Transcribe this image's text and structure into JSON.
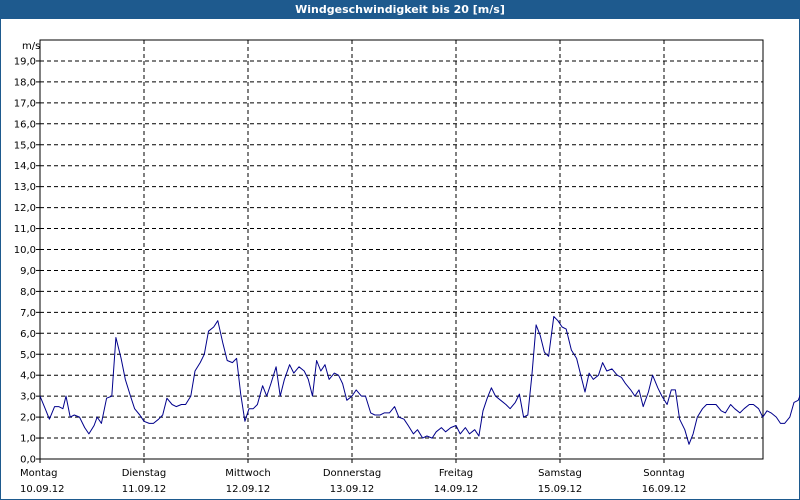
{
  "window": {
    "title": "Windgeschwindigkeit bis 20 [m/s]"
  },
  "colors": {
    "titlebar": "#1e5a8e",
    "series": "#00008b",
    "grid": "#000000"
  },
  "chart_data": {
    "type": "line",
    "title": "Windgeschwindigkeit bis 20 [m/s]",
    "ylabel": "m/s",
    "ylim": [
      0,
      20
    ],
    "ytick_labels": [
      "0,0",
      "1,0",
      "2,0",
      "3,0",
      "4,0",
      "5,0",
      "6,0",
      "7,0",
      "8,0",
      "9,0",
      "10,0",
      "11,0",
      "12,0",
      "13,0",
      "14,0",
      "15,0",
      "16,0",
      "17,0",
      "18,0",
      "19,0"
    ],
    "xlim": [
      0,
      7
    ],
    "grid": true,
    "days": [
      {
        "weekday": "Montag",
        "date": "10.09.12"
      },
      {
        "weekday": "Dienstag",
        "date": "11.09.12"
      },
      {
        "weekday": "Mittwoch",
        "date": "12.09.12"
      },
      {
        "weekday": "Donnerstag",
        "date": "13.09.12"
      },
      {
        "weekday": "Freitag",
        "date": "14.09.12"
      },
      {
        "weekday": "Samstag",
        "date": "15.09.12"
      },
      {
        "weekday": "Sonntag",
        "date": "16.09.12"
      }
    ],
    "series": [
      {
        "values": [
          [
            0.0,
            3.0
          ],
          [
            0.05,
            2.4
          ],
          [
            0.09,
            1.9
          ],
          [
            0.14,
            2.5
          ],
          [
            0.18,
            2.5
          ],
          [
            0.22,
            2.4
          ],
          [
            0.25,
            3.0
          ],
          [
            0.29,
            2.0
          ],
          [
            0.33,
            2.1
          ],
          [
            0.38,
            2.0
          ],
          [
            0.43,
            1.5
          ],
          [
            0.47,
            1.2
          ],
          [
            0.52,
            1.6
          ],
          [
            0.55,
            2.0
          ],
          [
            0.59,
            1.7
          ],
          [
            0.64,
            2.9
          ],
          [
            0.69,
            3.0
          ],
          [
            0.73,
            5.8
          ],
          [
            0.78,
            4.8
          ],
          [
            0.82,
            3.8
          ],
          [
            0.87,
            3.0
          ],
          [
            0.91,
            2.4
          ],
          [
            0.96,
            2.1
          ],
          [
            1.0,
            1.8
          ],
          [
            1.05,
            1.7
          ],
          [
            1.09,
            1.7
          ],
          [
            1.14,
            1.9
          ],
          [
            1.18,
            2.1
          ],
          [
            1.22,
            2.9
          ],
          [
            1.27,
            2.6
          ],
          [
            1.31,
            2.5
          ],
          [
            1.36,
            2.6
          ],
          [
            1.4,
            2.6
          ],
          [
            1.45,
            3.0
          ],
          [
            1.49,
            4.2
          ],
          [
            1.54,
            4.6
          ],
          [
            1.58,
            5.0
          ],
          [
            1.62,
            6.1
          ],
          [
            1.67,
            6.3
          ],
          [
            1.71,
            6.6
          ],
          [
            1.76,
            5.5
          ],
          [
            1.8,
            4.7
          ],
          [
            1.85,
            4.6
          ],
          [
            1.89,
            4.8
          ],
          [
            1.93,
            3.1
          ],
          [
            1.97,
            1.8
          ],
          [
            2.01,
            2.4
          ],
          [
            2.05,
            2.4
          ],
          [
            2.09,
            2.6
          ],
          [
            2.14,
            3.5
          ],
          [
            2.18,
            3.0
          ],
          [
            2.22,
            3.6
          ],
          [
            2.27,
            4.4
          ],
          [
            2.31,
            3.0
          ],
          [
            2.35,
            3.8
          ],
          [
            2.4,
            4.5
          ],
          [
            2.44,
            4.1
          ],
          [
            2.49,
            4.4
          ],
          [
            2.54,
            4.2
          ],
          [
            2.58,
            3.8
          ],
          [
            2.62,
            3.0
          ],
          [
            2.66,
            4.7
          ],
          [
            2.7,
            4.2
          ],
          [
            2.74,
            4.5
          ],
          [
            2.78,
            3.8
          ],
          [
            2.83,
            4.1
          ],
          [
            2.87,
            4.0
          ],
          [
            2.91,
            3.6
          ],
          [
            2.95,
            2.8
          ],
          [
            3.0,
            3.0
          ],
          [
            3.04,
            3.3
          ],
          [
            3.09,
            3.0
          ],
          [
            3.13,
            3.0
          ],
          [
            3.18,
            2.2
          ],
          [
            3.22,
            2.1
          ],
          [
            3.27,
            2.1
          ],
          [
            3.31,
            2.2
          ],
          [
            3.36,
            2.2
          ],
          [
            3.41,
            2.5
          ],
          [
            3.45,
            2.0
          ],
          [
            3.5,
            1.9
          ],
          [
            3.54,
            1.6
          ],
          [
            3.59,
            1.2
          ],
          [
            3.63,
            1.4
          ],
          [
            3.68,
            1.0
          ],
          [
            3.72,
            1.1
          ],
          [
            3.77,
            1.0
          ],
          [
            3.81,
            1.3
          ],
          [
            3.86,
            1.5
          ],
          [
            3.9,
            1.3
          ],
          [
            3.95,
            1.5
          ],
          [
            4.0,
            1.6
          ],
          [
            4.04,
            1.2
          ],
          [
            4.09,
            1.5
          ],
          [
            4.13,
            1.2
          ],
          [
            4.18,
            1.4
          ],
          [
            4.22,
            1.1
          ],
          [
            4.26,
            2.3
          ],
          [
            4.3,
            2.9
          ],
          [
            4.34,
            3.4
          ],
          [
            4.38,
            3.0
          ],
          [
            4.43,
            2.8
          ],
          [
            4.48,
            2.6
          ],
          [
            4.52,
            2.4
          ],
          [
            4.57,
            2.7
          ],
          [
            4.61,
            3.1
          ],
          [
            4.65,
            2.0
          ],
          [
            4.69,
            2.1
          ],
          [
            4.73,
            4.0
          ],
          [
            4.77,
            6.4
          ],
          [
            4.81,
            5.9
          ],
          [
            4.85,
            5.1
          ],
          [
            4.89,
            4.9
          ],
          [
            4.94,
            6.8
          ],
          [
            4.98,
            6.6
          ],
          [
            5.02,
            6.3
          ],
          [
            5.06,
            6.2
          ],
          [
            5.11,
            5.2
          ],
          [
            5.16,
            4.8
          ],
          [
            5.2,
            4.0
          ],
          [
            5.24,
            3.2
          ],
          [
            5.28,
            4.1
          ],
          [
            5.32,
            3.8
          ],
          [
            5.37,
            4.0
          ],
          [
            5.41,
            4.6
          ],
          [
            5.45,
            4.2
          ],
          [
            5.5,
            4.3
          ],
          [
            5.55,
            4.0
          ],
          [
            5.59,
            3.9
          ],
          [
            5.63,
            3.6
          ],
          [
            5.68,
            3.3
          ],
          [
            5.72,
            3.0
          ],
          [
            5.76,
            3.3
          ],
          [
            5.8,
            2.5
          ],
          [
            5.85,
            3.2
          ],
          [
            5.89,
            4.0
          ],
          [
            5.94,
            3.4
          ],
          [
            5.98,
            3.0
          ],
          [
            6.03,
            2.6
          ],
          [
            6.07,
            3.3
          ],
          [
            6.11,
            3.3
          ],
          [
            6.15,
            1.9
          ],
          [
            6.2,
            1.4
          ],
          [
            6.24,
            0.7
          ],
          [
            6.28,
            1.2
          ],
          [
            6.32,
            2.0
          ],
          [
            6.37,
            2.4
          ],
          [
            6.41,
            2.6
          ],
          [
            6.46,
            2.6
          ],
          [
            6.5,
            2.6
          ],
          [
            6.55,
            2.3
          ],
          [
            6.59,
            2.2
          ],
          [
            6.64,
            2.6
          ],
          [
            6.68,
            2.4
          ],
          [
            6.73,
            2.2
          ],
          [
            6.77,
            2.4
          ],
          [
            6.82,
            2.6
          ],
          [
            6.86,
            2.6
          ],
          [
            6.91,
            2.4
          ],
          [
            6.95,
            2.0
          ],
          [
            6.99,
            2.3
          ],
          [
            7.03,
            2.2
          ],
          [
            7.08,
            2.0
          ],
          [
            7.12,
            1.7
          ],
          [
            7.16,
            1.7
          ],
          [
            7.21,
            2.0
          ],
          [
            7.25,
            2.7
          ],
          [
            7.29,
            2.8
          ],
          [
            7.33,
            3.3
          ]
        ]
      }
    ]
  }
}
